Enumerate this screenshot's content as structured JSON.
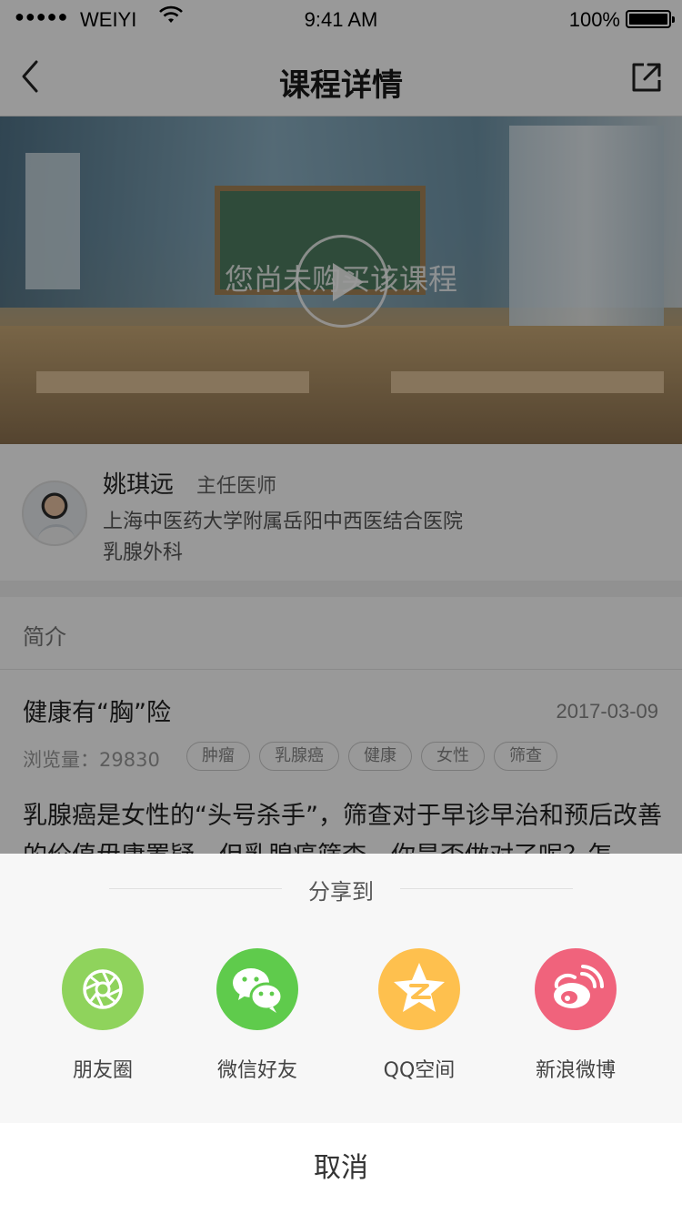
{
  "status_bar": {
    "signal": "●●●●●",
    "carrier": "WEIYI",
    "time": "9:41 AM",
    "battery": "100%"
  },
  "nav": {
    "title": "课程详情"
  },
  "video": {
    "locked_text": "您尚未购买该课程"
  },
  "doctor": {
    "name": "姚琪远",
    "rank": "主任医师",
    "hospital": "上海中医药大学附属岳阳中西医结合医院",
    "department": "乳腺外科"
  },
  "intro": {
    "label": "简介"
  },
  "article": {
    "title": "健康有“胸”险",
    "date": "2017-03-09",
    "views": "浏览量：29830",
    "tags": [
      "肿瘤",
      "乳腺癌",
      "健康",
      "女性",
      "筛查"
    ],
    "body": "乳腺癌是女性的“头号杀手”，筛查对于早诊早治和预后改善的价值毋庸置疑，但乳腺癌筛查，你是否做对了呢？怎"
  },
  "share_sheet": {
    "title": "分享到",
    "options": [
      {
        "label": "朋友圈",
        "icon": "moments-icon",
        "color": "#8fd35c"
      },
      {
        "label": "微信好友",
        "icon": "wechat-icon",
        "color": "#5fcb4c"
      },
      {
        "label": "QQ空间",
        "icon": "qzone-icon",
        "color": "#fec04e"
      },
      {
        "label": "新浪微博",
        "icon": "weibo-icon",
        "color": "#f0637c"
      }
    ],
    "cancel": "取消"
  }
}
